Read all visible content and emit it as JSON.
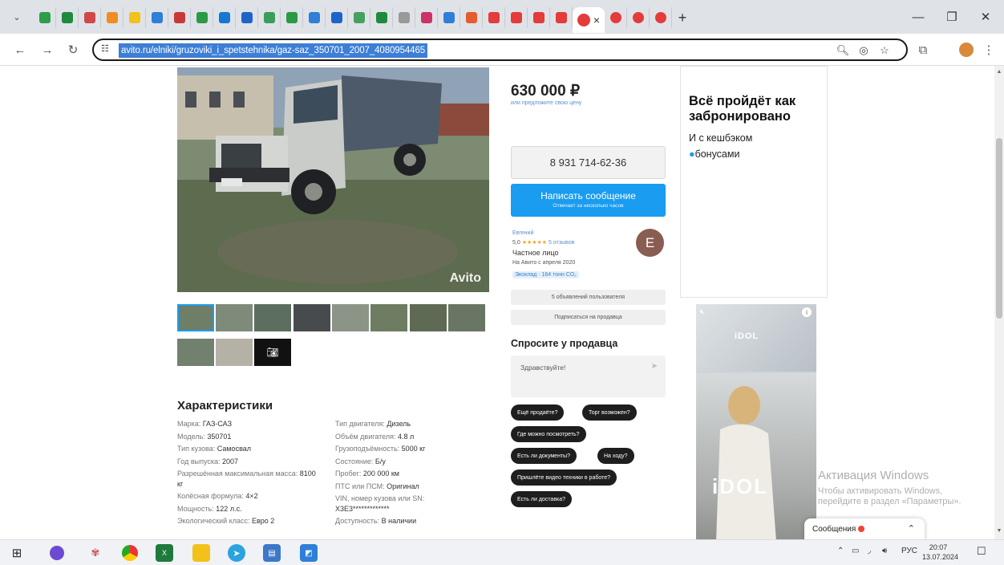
{
  "browser": {
    "tab_count": 31,
    "favicon_colors": [
      "#2e9e4a",
      "#1f8a3c",
      "#d04848",
      "#f08c22",
      "#f2c21b",
      "#2f7fd8",
      "#c83a3a",
      "#2a9a45",
      "#1778d2",
      "#1e64c8",
      "#3a9e5a",
      "#2a9a45",
      "#2f7fd8",
      "#1e64c8",
      "#46a05f",
      "#1f8a3c",
      "#999999",
      "#cc3366",
      "#2f7fd8",
      "#e65c2e",
      "#e43b3b",
      "#e43b3b",
      "#e43b3b",
      "#e43b3b"
    ],
    "active_close": "×",
    "right_favicon_colors": [
      "#e43b3b",
      "#e43b3b",
      "#e43b3b"
    ],
    "new_tab": "+",
    "url": "avito.ru/elniki/gruzoviki_i_spetstehnika/gaz-saz_350701_2007_4080954465"
  },
  "listing": {
    "watermark": "Avito",
    "more_photos_icon": "camera-icon",
    "characteristics_title": "Характеристики",
    "left_chars": [
      {
        "label": "Марка: ",
        "value": "ГАЗ-САЗ"
      },
      {
        "label": "Модель: ",
        "value": "350701"
      },
      {
        "label": "Тип кузова: ",
        "value": "Самосвал"
      },
      {
        "label": "Год выпуска: ",
        "value": "2007"
      },
      {
        "label": "Разрешённая максимальная масса: ",
        "value": "8100 кг"
      },
      {
        "label": "Колёсная формула: ",
        "value": "4×2"
      },
      {
        "label": "Мощность: ",
        "value": "122 л.с."
      },
      {
        "label": "Экологический класс: ",
        "value": "Евро 2"
      }
    ],
    "right_chars": [
      {
        "label": "Тип двигателя: ",
        "value": "Дизель"
      },
      {
        "label": "Объём двигателя: ",
        "value": "4.8 л"
      },
      {
        "label": "Грузоподъёмность: ",
        "value": "5000 кг"
      },
      {
        "label": "Состояние: ",
        "value": "Б/у"
      },
      {
        "label": "Пробег: ",
        "value": "200 000 км"
      },
      {
        "label": "ПТС или ПСМ: ",
        "value": "Оригинал"
      },
      {
        "label": "VIN, номер кузова или SN: ",
        "value": "X3E3*************"
      },
      {
        "label": "Доступность: ",
        "value": "В наличии"
      }
    ]
  },
  "sidebar": {
    "price": "630 000 ₽",
    "price_sub": "или предложите свою цену",
    "phone": "8 931 714-62-36",
    "write_message": "Написать сообщение",
    "write_message_sub": "Отвечает за несколько часов",
    "seller_name": "Евгений",
    "rating": "5,0",
    "stars": "★★★★★",
    "reviews": "5 отзывов",
    "seller_type": "Частное лицо",
    "on_avito_since": "На Авито с апреля 2020",
    "eco_badge": "Экоклад · 164 тонн CO₂",
    "avatar_letter": "E",
    "user_listings": "5 объявлений пользователя",
    "subscribe": "Подписаться на продавца",
    "ask_title": "Спросите у продавца",
    "ask_placeholder": "Здравствуйте!",
    "send_icon": "➤",
    "chips": [
      "Ещё продаёте?",
      "Торг возможен?",
      "Где можно посмотреть?",
      "Есть ли документы?",
      "На ходу?",
      "Пришлёте видео техники в работе?",
      "Есть ли доставка?"
    ]
  },
  "ad": {
    "title": "Всё пройдёт как забронировано",
    "subtitle": "И с кешбэком",
    "subtitle2": "бонусами",
    "brand_small": "iDOL",
    "brand_big": "iDOL"
  },
  "os": {
    "activate_title": "Активация Windows",
    "activate_sub": "Чтобы активировать Windows, перейдите в раздел «Параметры».",
    "messages_label": "Сообщения",
    "lang": "РУС",
    "time": "20:07",
    "date": "13.07.2024"
  }
}
